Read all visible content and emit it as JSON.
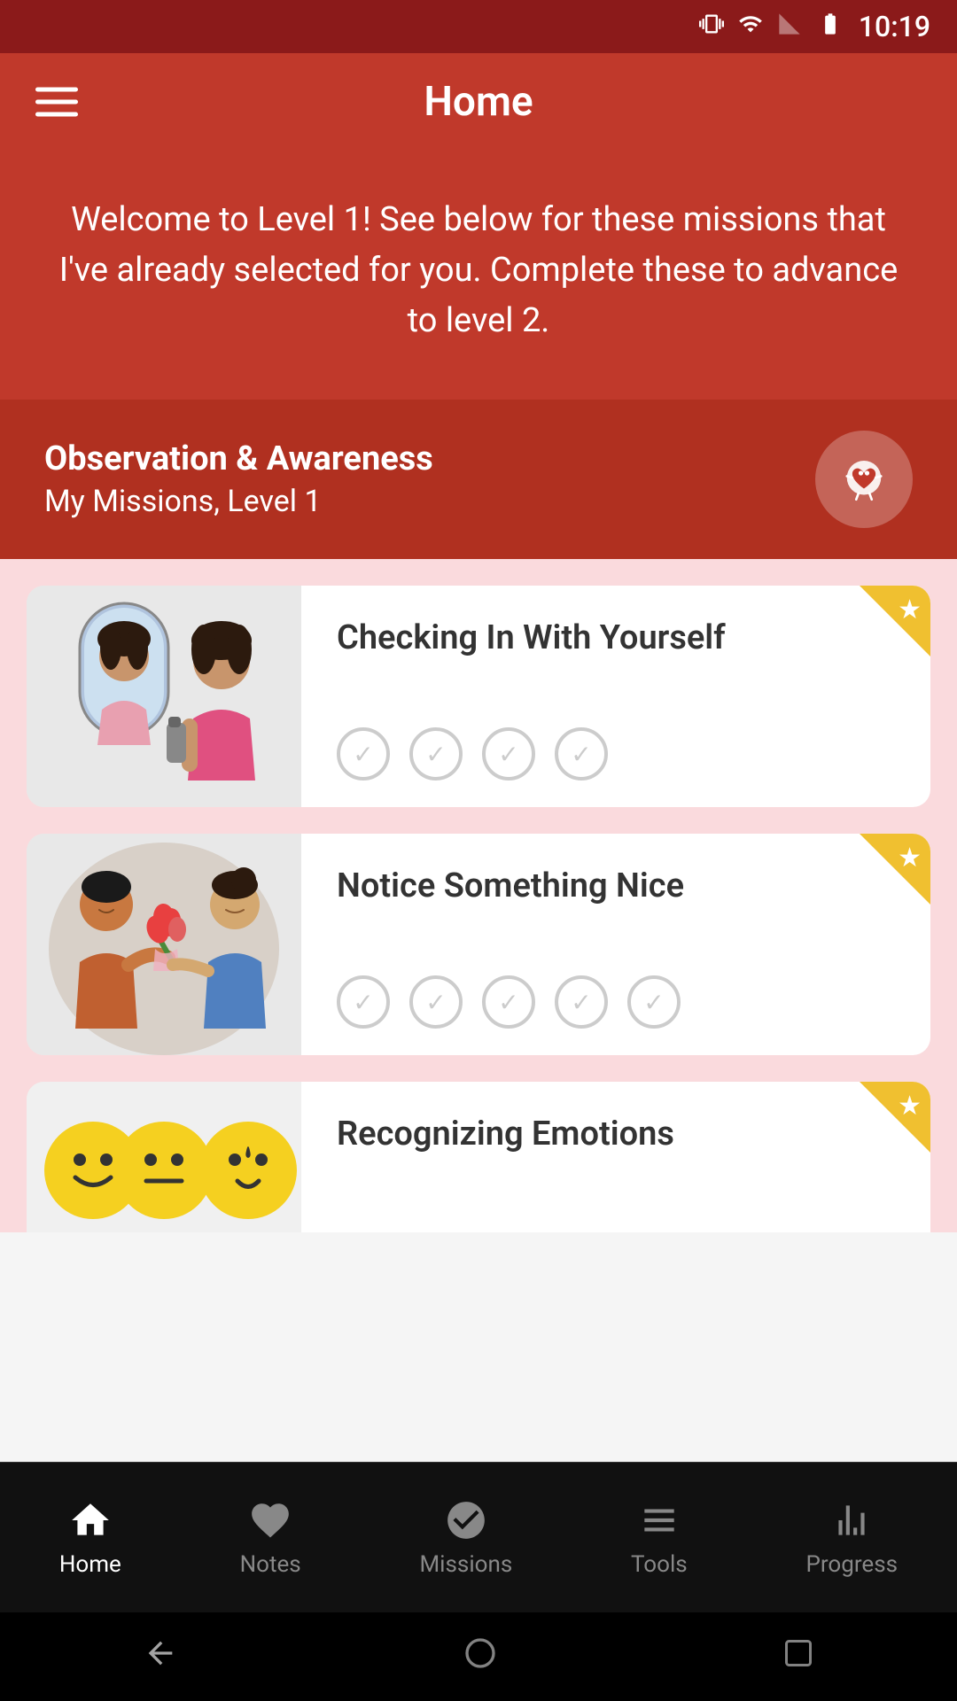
{
  "statusBar": {
    "time": "10:19"
  },
  "header": {
    "title": "Home",
    "menuLabel": "Menu"
  },
  "welcomeBanner": {
    "text": "Welcome to Level 1! See below for these missions that I've already selected for you. Complete these to advance to level 2."
  },
  "sectionHeader": {
    "title": "Observation & Awareness",
    "subtitle": "My Missions, Level 1",
    "mascotEmoji": "🤍"
  },
  "missions": [
    {
      "id": 1,
      "title": "Checking In With Yourself",
      "checkCount": 4,
      "starred": true
    },
    {
      "id": 2,
      "title": "Notice Something Nice",
      "checkCount": 5,
      "starred": true
    },
    {
      "id": 3,
      "title": "Recognizing Emotions",
      "checkCount": 0,
      "starred": true
    }
  ],
  "bottomNav": {
    "items": [
      {
        "id": "home",
        "label": "Home",
        "active": true
      },
      {
        "id": "notes",
        "label": "Notes",
        "active": false
      },
      {
        "id": "missions",
        "label": "Missions",
        "active": false
      },
      {
        "id": "tools",
        "label": "Tools",
        "active": false
      },
      {
        "id": "progress",
        "label": "Progress",
        "active": false
      }
    ]
  }
}
